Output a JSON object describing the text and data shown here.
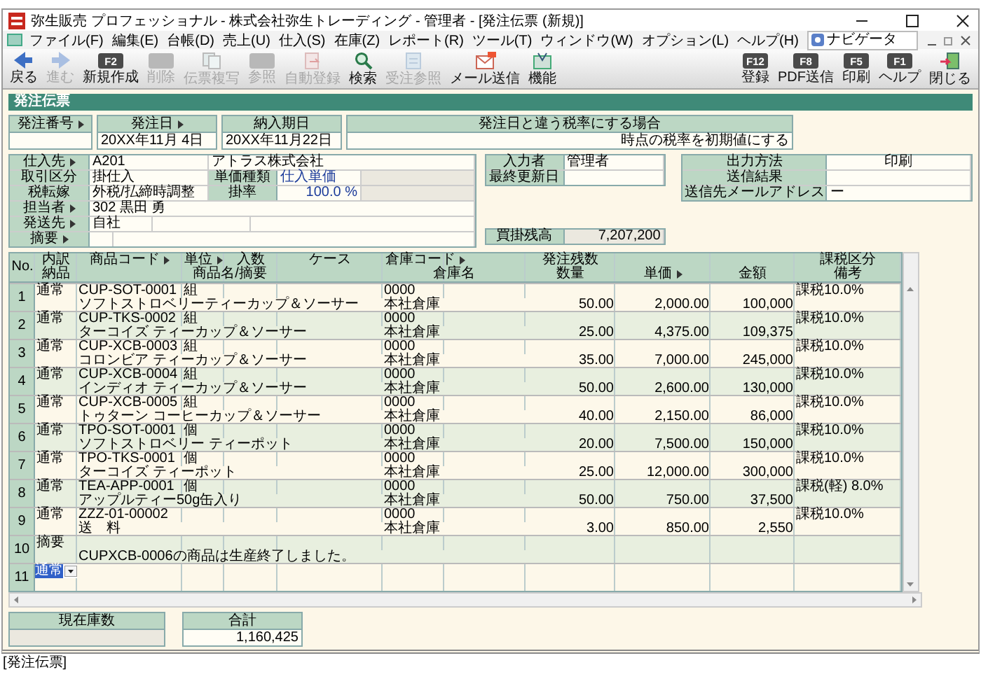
{
  "window": {
    "title": "弥生販売 プロフェッショナル - 株式会社弥生トレーディング - 管理者 - [発注伝票 (新規)]"
  },
  "menu": [
    "ファイル(F)",
    "編集(E)",
    "台帳(D)",
    "売上(U)",
    "仕入(S)",
    "在庫(Z)",
    "レポート(R)",
    "ツール(T)",
    "ウィンドウ(W)",
    "オプション(L)",
    "ヘルプ(H)"
  ],
  "navigator": {
    "label": "ナビゲータ"
  },
  "toolbar_left": [
    {
      "label": "戻る",
      "enabled": true
    },
    {
      "label": "進む",
      "enabled": false
    },
    {
      "label": "新規作成",
      "key": "F2",
      "enabled": true
    },
    {
      "label": "削除",
      "enabled": false
    },
    {
      "label": "伝票複写",
      "enabled": false
    },
    {
      "label": "参照",
      "enabled": false
    },
    {
      "label": "自動登録",
      "enabled": false
    },
    {
      "label": "検索",
      "enabled": true
    },
    {
      "label": "受注参照",
      "enabled": false
    },
    {
      "label": "メール送信",
      "enabled": true
    },
    {
      "label": "機能",
      "enabled": true
    }
  ],
  "toolbar_right": [
    {
      "label": "登録",
      "key": "F12",
      "enabled": true
    },
    {
      "label": "PDF送信",
      "key": "F8",
      "enabled": true
    },
    {
      "label": "印刷",
      "key": "F5",
      "enabled": true
    },
    {
      "label": "ヘルプ",
      "key": "F1",
      "enabled": true
    },
    {
      "label": "閉じる",
      "enabled": true
    }
  ],
  "form_title": "発注伝票",
  "header_fields": [
    {
      "label": "発注番号",
      "link": true
    },
    {
      "label": "発注日",
      "link": true,
      "value": "20XX年11月 4日"
    },
    {
      "label": "納入期日",
      "link": false,
      "value": "20XX年11月22日"
    },
    {
      "label": "発注日と違う税率にする場合",
      "link": false,
      "value": "時点の税率を初期値にする"
    }
  ],
  "purchase": {
    "supplier": {
      "label": "仕入先",
      "link": true,
      "code": "A201",
      "name": "アトラス株式会社"
    },
    "trade": {
      "label": "取引区分",
      "value": "掛仕入"
    },
    "price_type": {
      "label": "単価種類",
      "value": "仕入単価"
    },
    "tax": {
      "label": "税転嫁",
      "value": "外税/払締時調整"
    },
    "rate": {
      "label": "掛率",
      "value": "100.0 %"
    },
    "staff": {
      "label": "担当者",
      "link": true,
      "code": "302",
      "name": "黒田 勇"
    },
    "ship_to": {
      "label": "発送先",
      "link": true,
      "value": "自社"
    },
    "memo": {
      "label": "摘要",
      "link": true
    }
  },
  "entry": [
    {
      "label": "入力者",
      "value": "管理者"
    },
    {
      "label": "最終更新日"
    }
  ],
  "payable": {
    "label": "買掛残高",
    "value": "7,207,200"
  },
  "output": [
    {
      "label": "出力方法",
      "value": "印刷"
    },
    {
      "label": "送信結果"
    },
    {
      "label": "送信先メールアドレス",
      "value": "ー"
    }
  ],
  "columns_top": [
    {
      "label": "No.",
      "link": false
    },
    {
      "label": "内訳",
      "link": false
    },
    {
      "label": "商品コード",
      "link": true
    },
    {
      "label": "単位",
      "link": true
    },
    {
      "label": "入数",
      "link": false
    },
    {
      "label": "ケース",
      "link": false
    },
    {
      "label": "倉庫コード",
      "link": true
    },
    {
      "label": "発注残数",
      "link": false
    },
    {
      "label": "課税区分",
      "link": false
    }
  ],
  "columns_bottom": [
    {
      "label": "納品",
      "link": false
    },
    {
      "label": "商品名/摘要",
      "link": false
    },
    {
      "label": "倉庫名",
      "link": false
    },
    {
      "label": "数量",
      "link": false
    },
    {
      "label": "単価",
      "link": true
    },
    {
      "label": "金額",
      "link": false
    },
    {
      "label": "備考",
      "link": false
    }
  ],
  "rows": [
    {
      "kind": "item",
      "no": "1",
      "type": "通常",
      "code": "CUP-SOT-0001",
      "unit": "組",
      "name": "ソフトストロベリーティーカップ＆ソーサー",
      "wh_code": "0000",
      "wh_name": "本社倉庫",
      "qty": "50.00",
      "price": "2,000.00",
      "amount": "100,000",
      "tax": "課税10.0%"
    },
    {
      "kind": "item",
      "no": "2",
      "type": "通常",
      "code": "CUP-TKS-0002",
      "unit": "組",
      "name": "ターコイズ ティーカップ＆ソーサー",
      "wh_code": "0000",
      "wh_name": "本社倉庫",
      "qty": "25.00",
      "price": "4,375.00",
      "amount": "109,375",
      "tax": "課税10.0%"
    },
    {
      "kind": "item",
      "no": "3",
      "type": "通常",
      "code": "CUP-XCB-0003",
      "unit": "組",
      "name": "コロンビア ティーカップ＆ソーサー",
      "wh_code": "0000",
      "wh_name": "本社倉庫",
      "qty": "35.00",
      "price": "7,000.00",
      "amount": "245,000",
      "tax": "課税10.0%"
    },
    {
      "kind": "item",
      "no": "4",
      "type": "通常",
      "code": "CUP-XCB-0004",
      "unit": "組",
      "name": "インディオ ティーカップ＆ソーサー",
      "wh_code": "0000",
      "wh_name": "本社倉庫",
      "qty": "50.00",
      "price": "2,600.00",
      "amount": "130,000",
      "tax": "課税10.0%"
    },
    {
      "kind": "item",
      "no": "5",
      "type": "通常",
      "code": "CUP-XCB-0005",
      "unit": "組",
      "name": "トゥターン コーヒーカップ＆ソーサー",
      "wh_code": "0000",
      "wh_name": "本社倉庫",
      "qty": "40.00",
      "price": "2,150.00",
      "amount": "86,000",
      "tax": "課税10.0%"
    },
    {
      "kind": "item",
      "no": "6",
      "type": "通常",
      "code": "TPO-SOT-0001",
      "unit": "個",
      "name": "ソフトストロベリー ティーポット",
      "wh_code": "0000",
      "wh_name": "本社倉庫",
      "qty": "20.00",
      "price": "7,500.00",
      "amount": "150,000",
      "tax": "課税10.0%"
    },
    {
      "kind": "item",
      "no": "7",
      "type": "通常",
      "code": "TPO-TKS-0001",
      "unit": "個",
      "name": "ターコイズ ティーポット",
      "wh_code": "0000",
      "wh_name": "本社倉庫",
      "qty": "25.00",
      "price": "12,000.00",
      "amount": "300,000",
      "tax": "課税10.0%"
    },
    {
      "kind": "item",
      "no": "8",
      "type": "通常",
      "code": "TEA-APP-0001",
      "unit": "個",
      "name": "アップルティー50g缶入り",
      "wh_code": "0000",
      "wh_name": "本社倉庫",
      "qty": "50.00",
      "price": "750.00",
      "amount": "37,500",
      "tax": "課税(軽) 8.0%"
    },
    {
      "kind": "item",
      "no": "9",
      "type": "通常",
      "code": "ZZZ-01-00002",
      "name": "送　料",
      "wh_code": "0000",
      "wh_name": "本社倉庫",
      "qty": "3.00",
      "price": "850.00",
      "amount": "2,550",
      "tax": "課税10.0%"
    },
    {
      "kind": "memo",
      "no": "10",
      "type": "摘要",
      "text": "CUPXCB-0006の商品は生産終了しました。"
    },
    {
      "kind": "input",
      "no": "11",
      "type": "通常",
      "selected": true
    }
  ],
  "totals": [
    {
      "label": "現在庫数"
    },
    {
      "label": "合計",
      "value": "1,160,425"
    }
  ],
  "caption": "[発注伝票]"
}
